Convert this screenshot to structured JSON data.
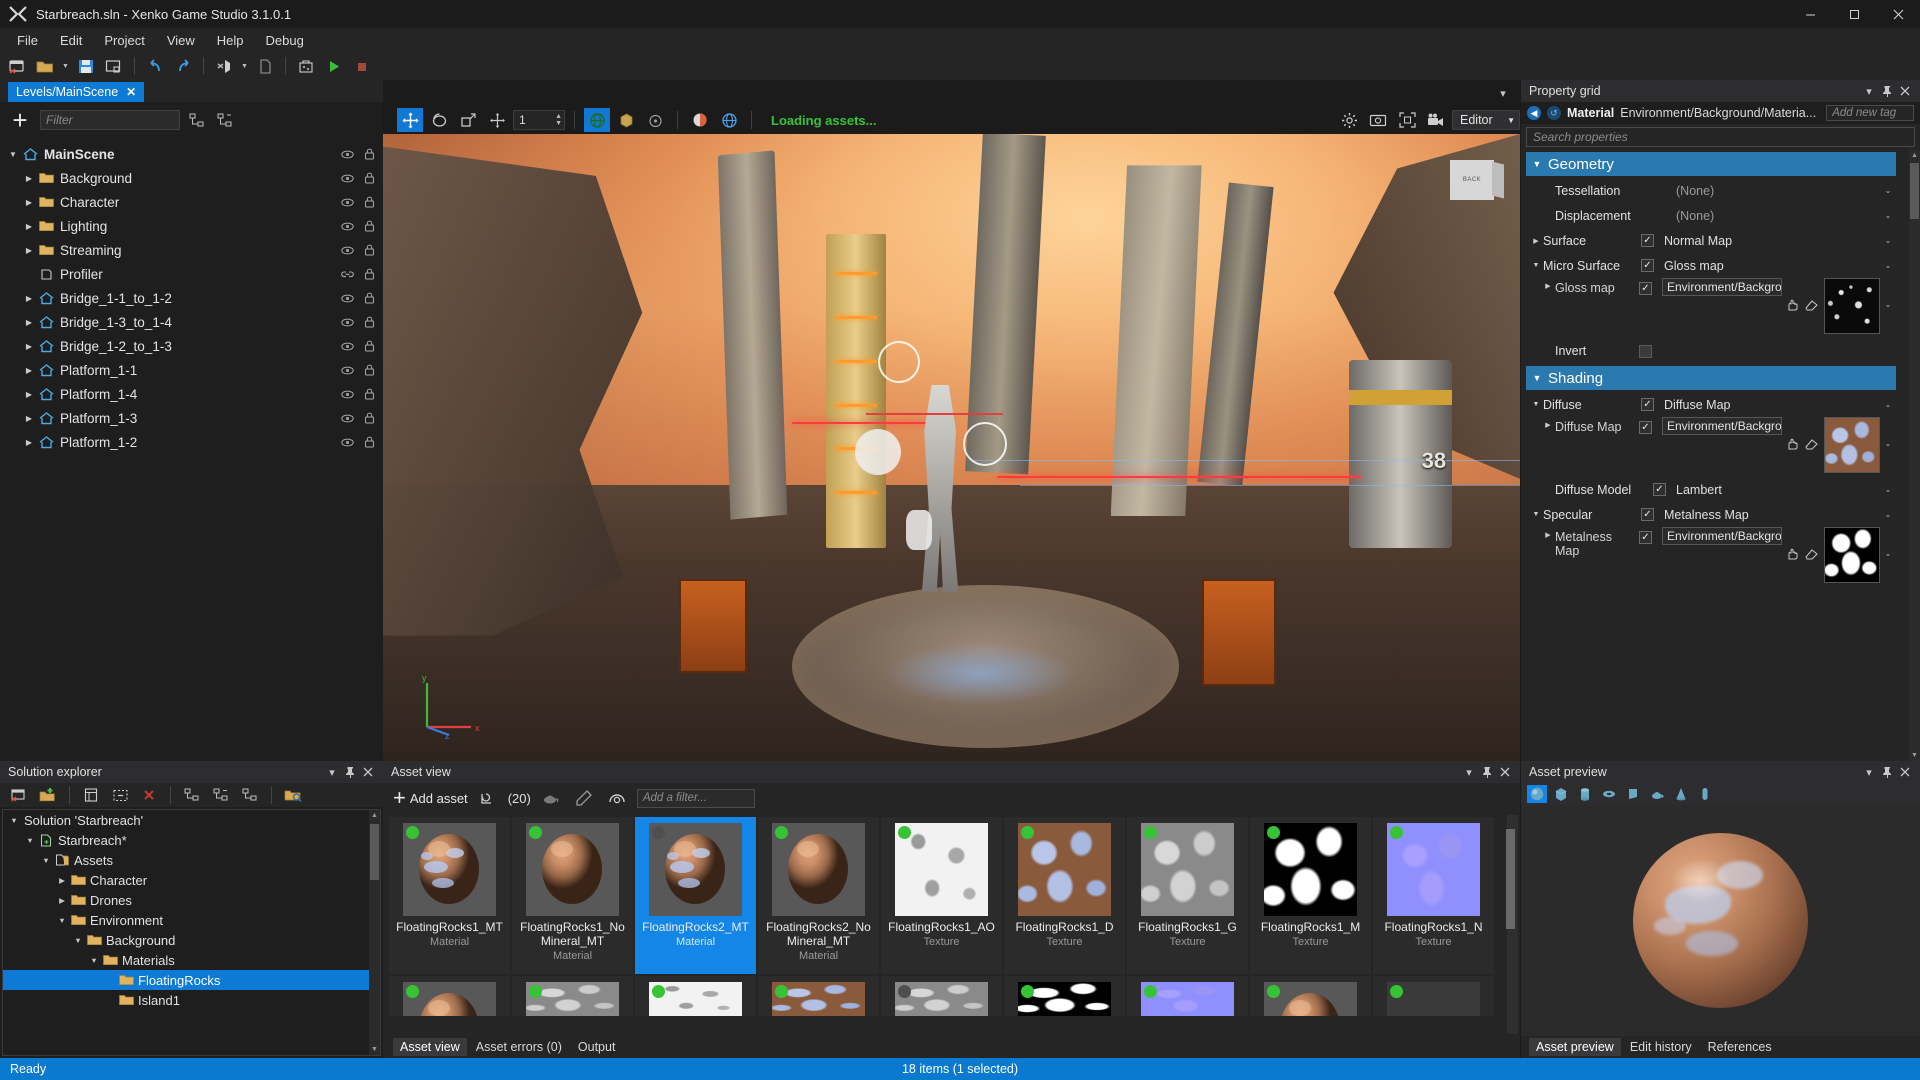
{
  "window": {
    "title": "Starbreach.sln - Xenko Game Studio 3.1.0.1",
    "logo_icon": "xenko-logo-icon",
    "minimize_label": "—",
    "maximize_label": "☐",
    "close_label": "✕"
  },
  "menu": {
    "items": [
      "File",
      "Edit",
      "Project",
      "View",
      "Help",
      "Debug"
    ]
  },
  "toolbar": {
    "buttons": [
      {
        "name": "new-project-icon"
      },
      {
        "name": "open-project-icon"
      },
      {
        "name": "open-dropdown-caret-icon"
      },
      {
        "name": "save-icon"
      },
      {
        "name": "save-all-icon"
      },
      {
        "name": "undo-icon"
      },
      {
        "name": "redo-icon"
      },
      {
        "name": "open-in-vs-icon"
      },
      {
        "name": "vs-dropdown-caret-icon"
      },
      {
        "name": "open-script-icon"
      },
      {
        "name": "build-icon"
      },
      {
        "name": "run-icon"
      },
      {
        "name": "stop-icon"
      }
    ]
  },
  "document_tab": {
    "label": "Levels/MainScene",
    "close_label": "✕"
  },
  "scene_toolbar": {
    "add_label": "+",
    "filter_placeholder": "Filter",
    "expand_all_icon": "expand-all-icon",
    "collapse_all_icon": "collapse-all-icon"
  },
  "scene_tree": {
    "nodes": [
      {
        "label": "MainScene",
        "indent": 0,
        "arrow": "down",
        "icon": "scene-icon",
        "eye": true,
        "lock": true,
        "bold": true
      },
      {
        "label": "Background",
        "indent": 1,
        "arrow": "right",
        "icon": "folder-icon",
        "eye": true,
        "lock": true
      },
      {
        "label": "Character",
        "indent": 1,
        "arrow": "right",
        "icon": "folder-icon",
        "eye": true,
        "lock": true
      },
      {
        "label": "Lighting",
        "indent": 1,
        "arrow": "right",
        "icon": "folder-icon",
        "eye": true,
        "lock": true
      },
      {
        "label": "Streaming",
        "indent": 1,
        "arrow": "right",
        "icon": "folder-icon",
        "eye": true,
        "lock": true
      },
      {
        "label": "Profiler",
        "indent": 1,
        "arrow": "none",
        "icon": "entity-icon",
        "eye": false,
        "lock": true,
        "link": true
      },
      {
        "label": "Bridge_1-1_to_1-2",
        "indent": 1,
        "arrow": "right",
        "icon": "scene-icon",
        "eye": true,
        "lock": true
      },
      {
        "label": "Bridge_1-3_to_1-4",
        "indent": 1,
        "arrow": "right",
        "icon": "scene-icon",
        "eye": true,
        "lock": true
      },
      {
        "label": "Bridge_1-2_to_1-3",
        "indent": 1,
        "arrow": "right",
        "icon": "scene-icon",
        "eye": true,
        "lock": true
      },
      {
        "label": "Platform_1-1",
        "indent": 1,
        "arrow": "right",
        "icon": "scene-icon",
        "eye": true,
        "lock": true
      },
      {
        "label": "Platform_1-4",
        "indent": 1,
        "arrow": "right",
        "icon": "scene-icon",
        "eye": true,
        "lock": true
      },
      {
        "label": "Platform_1-3",
        "indent": 1,
        "arrow": "right",
        "icon": "scene-icon",
        "eye": true,
        "lock": true
      },
      {
        "label": "Platform_1-2",
        "indent": 1,
        "arrow": "right",
        "icon": "scene-icon",
        "eye": true,
        "lock": true
      }
    ]
  },
  "viewport": {
    "toolbar": {
      "translate_icon": "translate-gizmo-icon",
      "rotate_icon": "rotate-gizmo-icon",
      "scale_icon": "scale-gizmo-icon",
      "snap_icon": "snap-icon",
      "snap_value": "1",
      "world_space_icon": "world-space-icon",
      "local_space_icon": "local-space-icon",
      "pivot_icon": "pivot-icon",
      "lighting_icon": "lighting-toggle-icon",
      "navigation_icon": "navigation-mesh-icon",
      "status_text": "Loading assets..."
    },
    "right_toolbar": {
      "options_caret_icon": "options-caret-icon",
      "gizmo_options_icon": "gizmo-options-icon",
      "screenshot_icon": "screenshot-icon",
      "fit_view_icon": "fit-selection-icon",
      "camera_icon": "camera-icon",
      "camera_mode": "Editor"
    },
    "navcube_label": "BACK",
    "hud_number": "38"
  },
  "property_grid": {
    "panel_title": "Property grid",
    "header_icons": [
      "collapse-caret-icon",
      "pin-icon",
      "close-icon"
    ],
    "nav_back_icon": "navigate-back-icon",
    "nav_reset_icon": "reset-icon",
    "breadcrumb_type": "Material",
    "breadcrumb_path": "Environment/Background/Materia...",
    "tag_placeholder": "Add new tag",
    "search_placeholder": "Search properties",
    "sections": [
      {
        "title": "Geometry",
        "rows": [
          {
            "name": "Tessellation",
            "indent": 1,
            "arrow": "none",
            "checkbox": null,
            "value": "(None)",
            "value_dim": true,
            "dropdown": true,
            "kind": "value"
          },
          {
            "name": "Displacement",
            "indent": 1,
            "arrow": "none",
            "checkbox": null,
            "value": "(None)",
            "value_dim": true,
            "dropdown": true,
            "kind": "value"
          },
          {
            "name": "Surface",
            "indent": 0,
            "arrow": "right",
            "checkbox": true,
            "value": "Normal Map",
            "value_dim": false,
            "dropdown": true,
            "kind": "value"
          },
          {
            "name": "Micro Surface",
            "indent": 0,
            "arrow": "down",
            "checkbox": true,
            "value": "Gloss map",
            "value_dim": false,
            "dropdown": true,
            "kind": "value"
          },
          {
            "name": "Gloss map",
            "indent": 1,
            "arrow": "right",
            "checkbox": true,
            "value": "Environment/Backgro",
            "kind": "texture",
            "thumb": "gloss-map-thumbnail",
            "dropdown": true
          },
          {
            "name": "Invert",
            "indent": 1,
            "arrow": "none",
            "checkbox": false,
            "value": "",
            "kind": "checkbox-only"
          }
        ]
      },
      {
        "title": "Shading",
        "rows": [
          {
            "name": "Diffuse",
            "indent": 0,
            "arrow": "down",
            "checkbox": true,
            "value": "Diffuse Map",
            "value_dim": false,
            "dropdown": true,
            "kind": "value"
          },
          {
            "name": "Diffuse Map",
            "indent": 1,
            "arrow": "right",
            "checkbox": true,
            "value": "Environment/Backgro",
            "kind": "texture",
            "thumb": "diffuse-map-thumbnail",
            "dropdown": true
          },
          {
            "name": "Diffuse Model",
            "indent": 1,
            "arrow": "none",
            "checkbox": true,
            "value": "Lambert",
            "value_dim": false,
            "dropdown": true,
            "kind": "value"
          },
          {
            "name": "Specular",
            "indent": 0,
            "arrow": "down",
            "checkbox": true,
            "value": "Metalness Map",
            "value_dim": false,
            "dropdown": true,
            "kind": "value"
          },
          {
            "name": "Metalness Map",
            "indent": 1,
            "arrow": "right",
            "checkbox": true,
            "value": "Environment/Backgro",
            "kind": "texture",
            "thumb": "metalness-map-thumbnail",
            "dropdown": true
          }
        ]
      }
    ],
    "texture_tools": {
      "pick_icon": "pick-hand-icon",
      "clear_icon": "clear-eraser-icon"
    }
  },
  "solution_explorer": {
    "panel_title": "Solution explorer",
    "header_icons": [
      "collapse-caret-icon",
      "pin-icon",
      "close-icon"
    ],
    "toolbar_icons": [
      "new-package-icon",
      "add-package-icon",
      "properties-icon",
      "show-all-icon",
      "delete-icon",
      "expand-all-icon",
      "collapse-all-icon",
      "sync-selection-icon",
      "locate-in-explorer-icon"
    ],
    "nodes": [
      {
        "label": "Solution 'Starbreach'",
        "indent": 0,
        "arrow": "down",
        "icon": "solution-icon"
      },
      {
        "label": "Starbreach*",
        "indent": 1,
        "arrow": "down",
        "icon": "package-icon"
      },
      {
        "label": "Assets",
        "indent": 2,
        "arrow": "down",
        "icon": "assets-icon"
      },
      {
        "label": "Character",
        "indent": 3,
        "arrow": "right",
        "icon": "folder-icon"
      },
      {
        "label": "Drones",
        "indent": 3,
        "arrow": "right",
        "icon": "folder-icon"
      },
      {
        "label": "Environment",
        "indent": 3,
        "arrow": "down",
        "icon": "folder-icon"
      },
      {
        "label": "Background",
        "indent": 4,
        "arrow": "down",
        "icon": "folder-icon"
      },
      {
        "label": "Materials",
        "indent": 5,
        "arrow": "down",
        "icon": "folder-icon"
      },
      {
        "label": "FloatingRocks",
        "indent": 6,
        "arrow": "none",
        "icon": "folder-icon",
        "selected": true
      },
      {
        "label": "Island1",
        "indent": 6,
        "arrow": "none",
        "icon": "folder-icon"
      }
    ]
  },
  "asset_view": {
    "panel_title": "Asset view",
    "header_icons": [
      "collapse-caret-icon",
      "pin-icon",
      "close-icon"
    ],
    "add_asset_label": "Add asset",
    "refresh_count": "(20)",
    "refresh_icon": "refresh-icon",
    "teapot_icon": "thumbnail-preview-icon",
    "edit_icon": "edit-pencil-icon",
    "eye_icon": "preview-eye-icon",
    "filter_placeholder": "Add a filter...",
    "items": [
      {
        "name": "FloatingRocks1_MT",
        "type": "Material",
        "thumb": "sphere-rock-mineral",
        "status": "green",
        "selected": false
      },
      {
        "name": "FloatingRocks1_NoMineral_MT",
        "type": "Material",
        "thumb": "sphere-rock-plain",
        "status": "green",
        "selected": false
      },
      {
        "name": "FloatingRocks2_MT",
        "type": "Material",
        "thumb": "sphere-rock-mineral2",
        "status": "grey",
        "selected": true
      },
      {
        "name": "FloatingRocks2_NoMineral_MT",
        "type": "Material",
        "thumb": "sphere-rock-plain2",
        "status": "green",
        "selected": false
      },
      {
        "name": "FloatingRocks1_AO",
        "type": "Texture",
        "thumb": "texture-ao",
        "status": "green",
        "selected": false
      },
      {
        "name": "FloatingRocks1_D",
        "type": "Texture",
        "thumb": "texture-diffuse",
        "status": "green",
        "selected": false
      },
      {
        "name": "FloatingRocks1_G",
        "type": "Texture",
        "thumb": "texture-gloss",
        "status": "green",
        "selected": false
      },
      {
        "name": "FloatingRocks1_M",
        "type": "Texture",
        "thumb": "texture-metalness",
        "status": "green",
        "selected": false
      },
      {
        "name": "FloatingRocks1_N",
        "type": "Texture",
        "thumb": "texture-normal",
        "status": "green",
        "selected": false
      }
    ],
    "row2_thumbs": [
      "sphere-rock",
      "texture-gloss2",
      "texture-ao2",
      "texture-diffuse2",
      "texture-gloss3",
      "texture-metalness2",
      "texture-normal2",
      "sphere-rock2",
      "texture-grey"
    ],
    "tabs": [
      {
        "label": "Asset view",
        "active": true
      },
      {
        "label": "Asset errors (0)",
        "active": false
      },
      {
        "label": "Output",
        "active": false
      }
    ]
  },
  "asset_preview": {
    "panel_title": "Asset preview",
    "header_icons": [
      "collapse-caret-icon",
      "pin-icon",
      "close-icon"
    ],
    "shapes": [
      {
        "name": "sphere-preview-shape",
        "selected": true
      },
      {
        "name": "cube-preview-shape",
        "selected": false
      },
      {
        "name": "cylinder-preview-shape",
        "selected": false
      },
      {
        "name": "torus-preview-shape",
        "selected": false
      },
      {
        "name": "plane-preview-shape",
        "selected": false
      },
      {
        "name": "teapot-preview-shape",
        "selected": false
      },
      {
        "name": "cone-preview-shape",
        "selected": false
      },
      {
        "name": "capsule-preview-shape",
        "selected": false
      }
    ],
    "tabs": [
      {
        "label": "Asset preview",
        "active": true
      },
      {
        "label": "Edit history",
        "active": false
      },
      {
        "label": "References",
        "active": false
      }
    ]
  },
  "status_bar": {
    "left": "Ready",
    "right": "18 items (1 selected)"
  },
  "colors": {
    "accent": "#0d7ad6",
    "section_header": "#2a7ab0",
    "status_bar": "#0a7ad1",
    "status_ok": "#36c436",
    "loading_text": "#36c436",
    "panel_bg": "#252526",
    "tree_bg": "#1e1e1e"
  }
}
